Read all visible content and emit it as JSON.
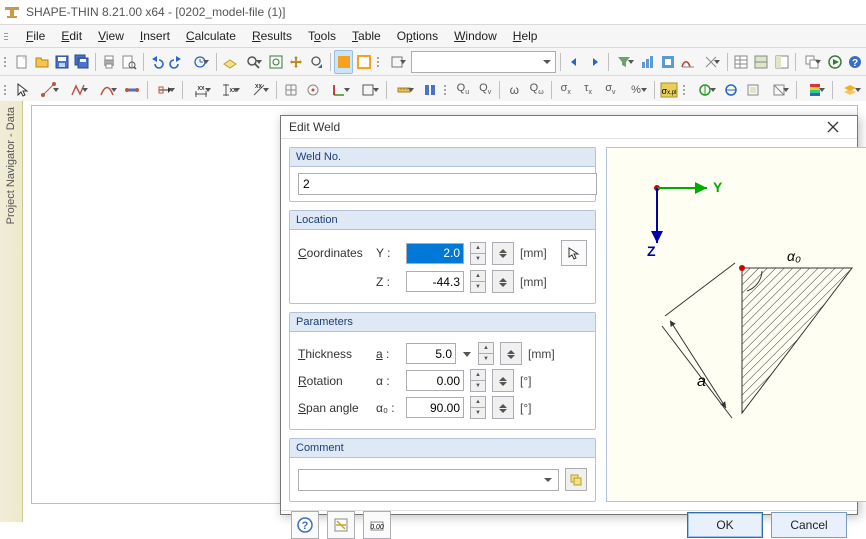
{
  "title": "SHAPE-THIN 8.21.00 x64 - [0202_model-file (1)]",
  "menu": [
    "File",
    "Edit",
    "View",
    "Insert",
    "Calculate",
    "Results",
    "Tools",
    "Table",
    "Options",
    "Window",
    "Help"
  ],
  "nav_strip": "Project Navigator - Data",
  "dialog": {
    "title": "Edit Weld",
    "sections": {
      "weld_no": {
        "header": "Weld No.",
        "value": "2"
      },
      "location": {
        "header": "Location",
        "coordinates_label": "Coordinates",
        "y_label": "Y :",
        "y_value": "2.0",
        "y_unit": "[mm]",
        "z_label": "Z :",
        "z_value": "-44.3",
        "z_unit": "[mm]"
      },
      "parameters": {
        "header": "Parameters",
        "thickness_label": "Thickness",
        "thickness_sym": "a :",
        "thickness_value": "5.0",
        "thickness_unit": "[mm]",
        "rotation_label": "Rotation",
        "rotation_sym": "α :",
        "rotation_value": "0.00",
        "rotation_unit": "[°]",
        "span_label": "Span angle",
        "span_sym": "α₀ :",
        "span_value": "90.00",
        "span_unit": "[°]"
      },
      "comment": {
        "header": "Comment",
        "value": ""
      }
    },
    "preview": {
      "y_axis": "Y",
      "z_axis": "Z",
      "a_label": "a",
      "alpha0_label": "α₀"
    },
    "buttons": {
      "ok": "OK",
      "cancel": "Cancel"
    }
  },
  "toolbars": {
    "combo_value": ""
  }
}
